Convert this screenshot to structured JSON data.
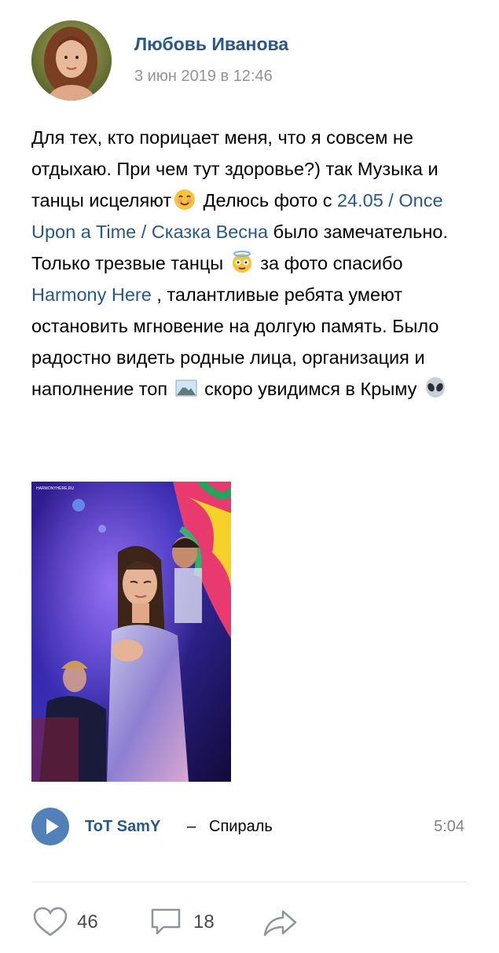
{
  "author": {
    "name": "Любовь Иванова",
    "date": "3 июн 2019 в 12:46"
  },
  "post": {
    "p1": "Для тех, кто порицает меня, что я совсем не отдыхаю. При чем тут здоровье?) так Музыка и танцы исцеляют",
    "emoji_smile": "smiling-face-emoji",
    "p2": " Делюсь фото с ",
    "link_event": "24.05 / Once Upon a Time / Сказка Весна",
    "p3": " было замечательно. Только трезвые танцы ",
    "emoji_halo": "halo-face-emoji",
    "p4": " за фото спасибо ",
    "link_photographer": "Harmony Here",
    "p5": " , талантливые ребята умеют остановить мгновение на долгую память. Было радостно видеть родные лица, организация и наполнение топ ",
    "emoji_mountain": "mountain-picture-emoji",
    "p6": " скоро увидимся в Крыму ",
    "emoji_alien": "alien-emoji"
  },
  "photo": {
    "watermark": "HARMONYHERE.RU"
  },
  "audio": {
    "artist": "ToT SamY",
    "dash": "–",
    "title": "Спираль",
    "duration": "5:04"
  },
  "actions": {
    "likes": "46",
    "comments": "18",
    "icons": {
      "like": "heart-icon",
      "comment": "comment-icon",
      "share": "share-icon"
    }
  },
  "colors": {
    "link": "#2a5885",
    "play": "#5181b8",
    "muted": "#939393"
  }
}
